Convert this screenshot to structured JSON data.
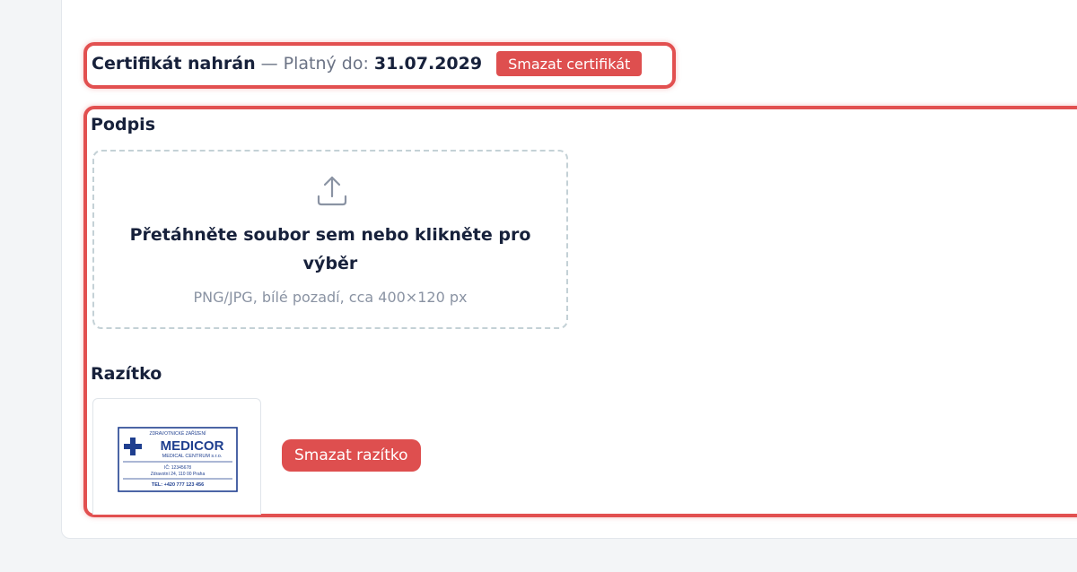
{
  "certificate": {
    "status": "Certifikát nahrán",
    "separator": "—",
    "valid_label": "Platný do:",
    "valid_date": "31.07.2029",
    "delete_label": "Smazat certifikát"
  },
  "signature": {
    "label": "Podpis",
    "dropzone": {
      "title": "Přetáhněte soubor sem nebo klikněte pro výběr",
      "hint": "PNG/JPG, bílé pozadí, cca 400×120 px",
      "icon": "upload-icon"
    }
  },
  "stamp": {
    "label": "Razítko",
    "image": {
      "line1": "ZDRAVOTNICKÉ ZAŘÍZENÍ",
      "brand": "MEDICOR",
      "subbrand": "MEDICAL CENTRUM s.r.o.",
      "ic": "IČ: 12345678",
      "address": "Zdravotní 24, 110 00 Praha",
      "tel": "TEL: +420 777 123 456"
    },
    "delete_label": "Smazat razítko"
  },
  "colors": {
    "danger": "#de4f4f",
    "highlight": "#e25050",
    "text": "#17213b",
    "muted": "#6b7385",
    "stamp_blue": "#1f3f8f"
  }
}
